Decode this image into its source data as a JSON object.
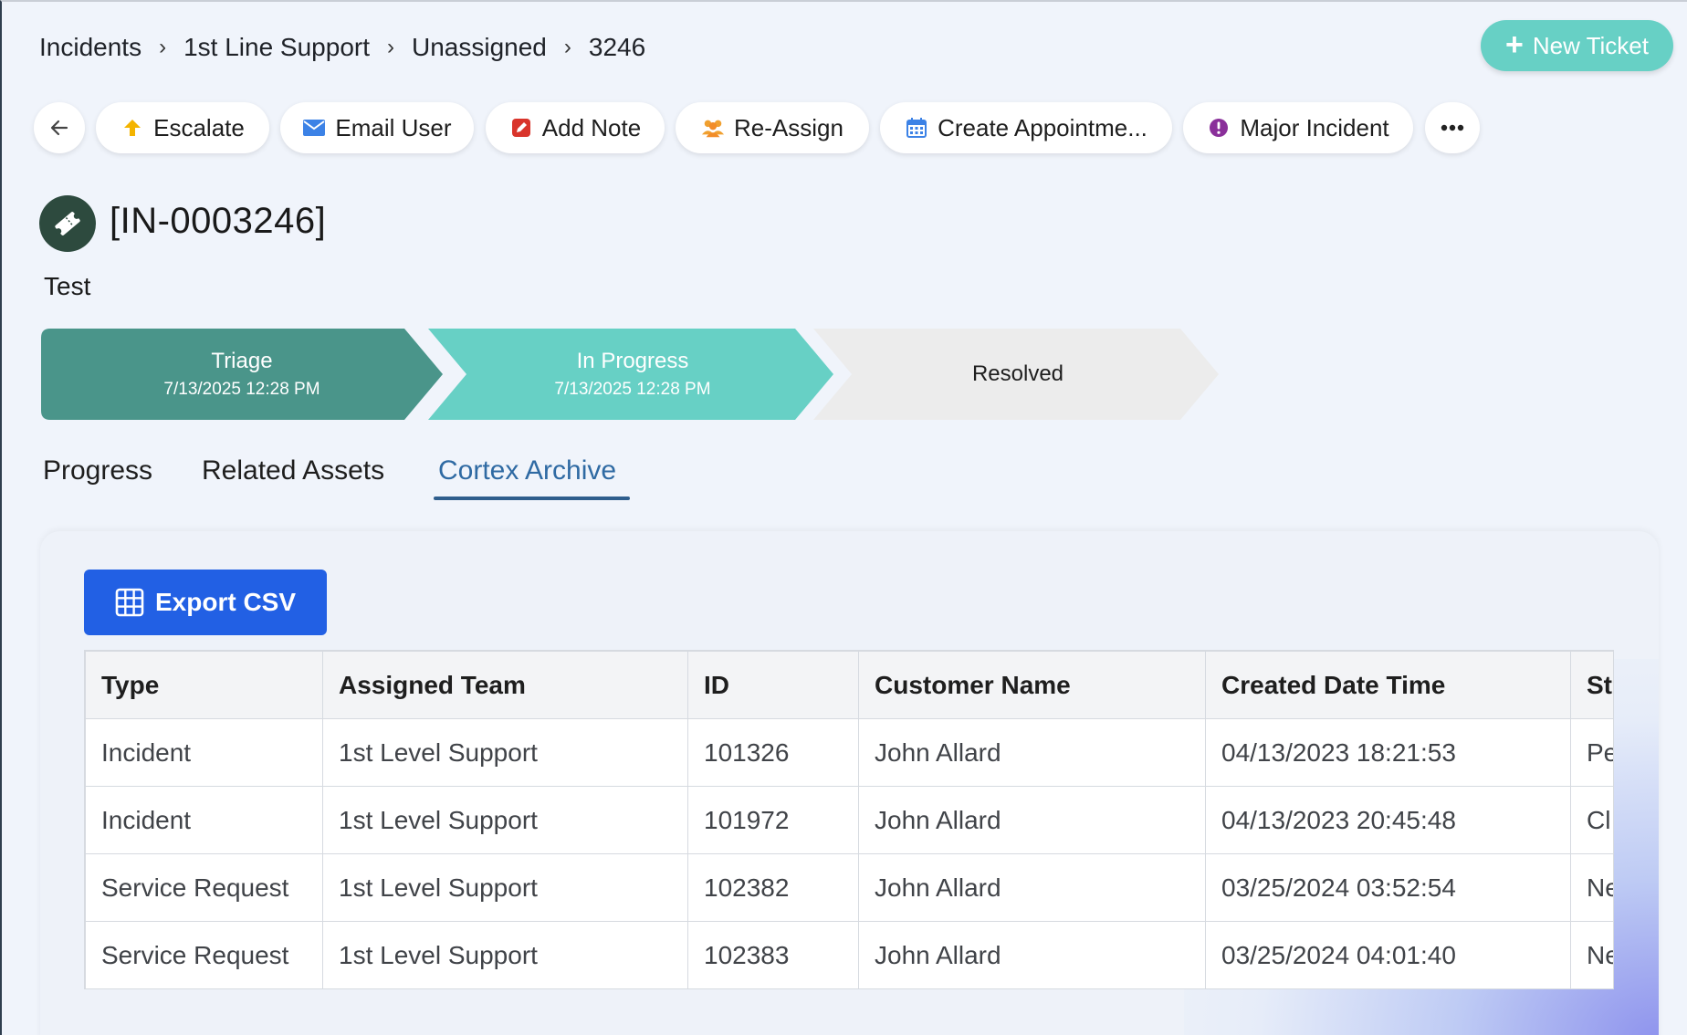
{
  "breadcrumb": [
    "Incidents",
    "1st Line Support",
    "Unassigned",
    "3246"
  ],
  "new_ticket_label": "New Ticket",
  "toolbar": {
    "escalate": "Escalate",
    "email_user": "Email User",
    "add_note": "Add Note",
    "reassign": "Re-Assign",
    "create_appointment": "Create Appointme...",
    "major_incident": "Major Incident"
  },
  "ticket": {
    "id": "[IN-0003246]",
    "subject": "Test"
  },
  "stages": [
    {
      "name": "Triage",
      "date": "7/13/2025 12:28 PM",
      "status": "completed",
      "color": "#4a958a"
    },
    {
      "name": "In Progress",
      "date": "7/13/2025 12:28 PM",
      "status": "current",
      "color": "#67d0c5"
    },
    {
      "name": "Resolved",
      "date": "",
      "status": "pending",
      "color": "#ececec"
    }
  ],
  "tabs": [
    {
      "label": "Progress",
      "active": false
    },
    {
      "label": "Related Assets",
      "active": false
    },
    {
      "label": "Cortex Archive",
      "active": true
    }
  ],
  "archive": {
    "export_label": "Export CSV",
    "columns": [
      "Type",
      "Assigned Team",
      "ID",
      "Customer Name",
      "Created Date Time",
      "St"
    ],
    "rows": [
      [
        "Incident",
        "1st Level Support",
        "101326",
        "John Allard",
        "04/13/2023 18:21:53",
        "Pe"
      ],
      [
        "Incident",
        "1st Level Support",
        "101972",
        "John Allard",
        "04/13/2023 20:45:48",
        "Cl"
      ],
      [
        "Service Request",
        "1st Level Support",
        "102382",
        "John Allard",
        "03/25/2024 03:52:54",
        "Ne"
      ],
      [
        "Service Request",
        "1st Level Support",
        "102383",
        "John Allard",
        "03/25/2024 04:01:40",
        "Ne"
      ]
    ]
  },
  "icons": {
    "escalate": "arrow-up-icon",
    "email": "envelope-icon",
    "note": "pencil-square-icon",
    "reassign": "users-icon",
    "appointment": "calendar-icon",
    "major": "exclamation-circle-icon"
  }
}
